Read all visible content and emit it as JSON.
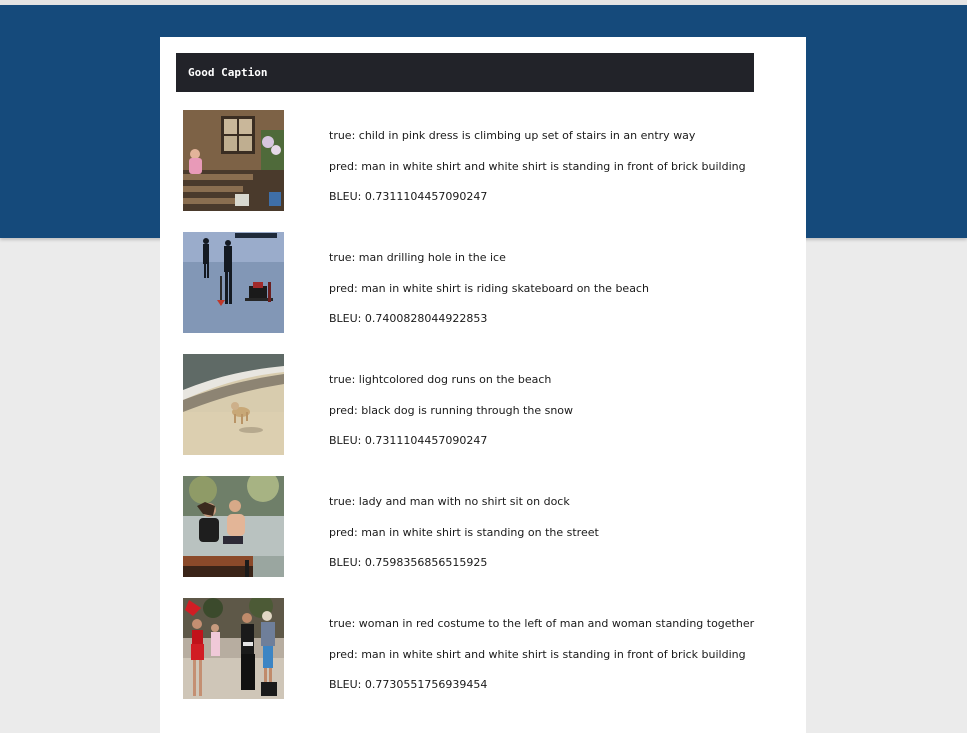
{
  "page": {
    "header_title": "Good Caption",
    "colors": {
      "hero_band": "#154a7b",
      "header_bar": "#222329",
      "background": "#ebebeb",
      "card": "#ffffff"
    }
  },
  "captions": [
    {
      "image": "child-on-stairs-photo",
      "true_text": "true: child in pink dress is climbing up set of stairs in an entry way",
      "pred_text": "pred: man in white shirt and white shirt is standing in front of brick building",
      "bleu_text": "BLEU: 0.7311104457090247"
    },
    {
      "image": "ice-drilling-photo",
      "true_text": "true: man drilling hole in the ice",
      "pred_text": "pred: man in white shirt is riding skateboard on the beach",
      "bleu_text": "BLEU: 0.7400828044922853"
    },
    {
      "image": "dog-on-beach-photo",
      "true_text": "true: lightcolored dog runs on the beach",
      "pred_text": "pred: black dog is running through the snow",
      "bleu_text": "BLEU: 0.7311104457090247"
    },
    {
      "image": "couple-on-dock-photo",
      "true_text": "true: lady and man with no shirt sit on dock",
      "pred_text": "pred: man in white shirt is standing on the street",
      "bleu_text": "BLEU: 0.7598356856515925"
    },
    {
      "image": "red-costume-photo",
      "true_text": "true: woman in red costume to the left of man and woman standing together",
      "pred_text": "pred: man in white shirt and white shirt is standing in front of brick building",
      "bleu_text": "BLEU: 0.7730551756939454"
    }
  ]
}
